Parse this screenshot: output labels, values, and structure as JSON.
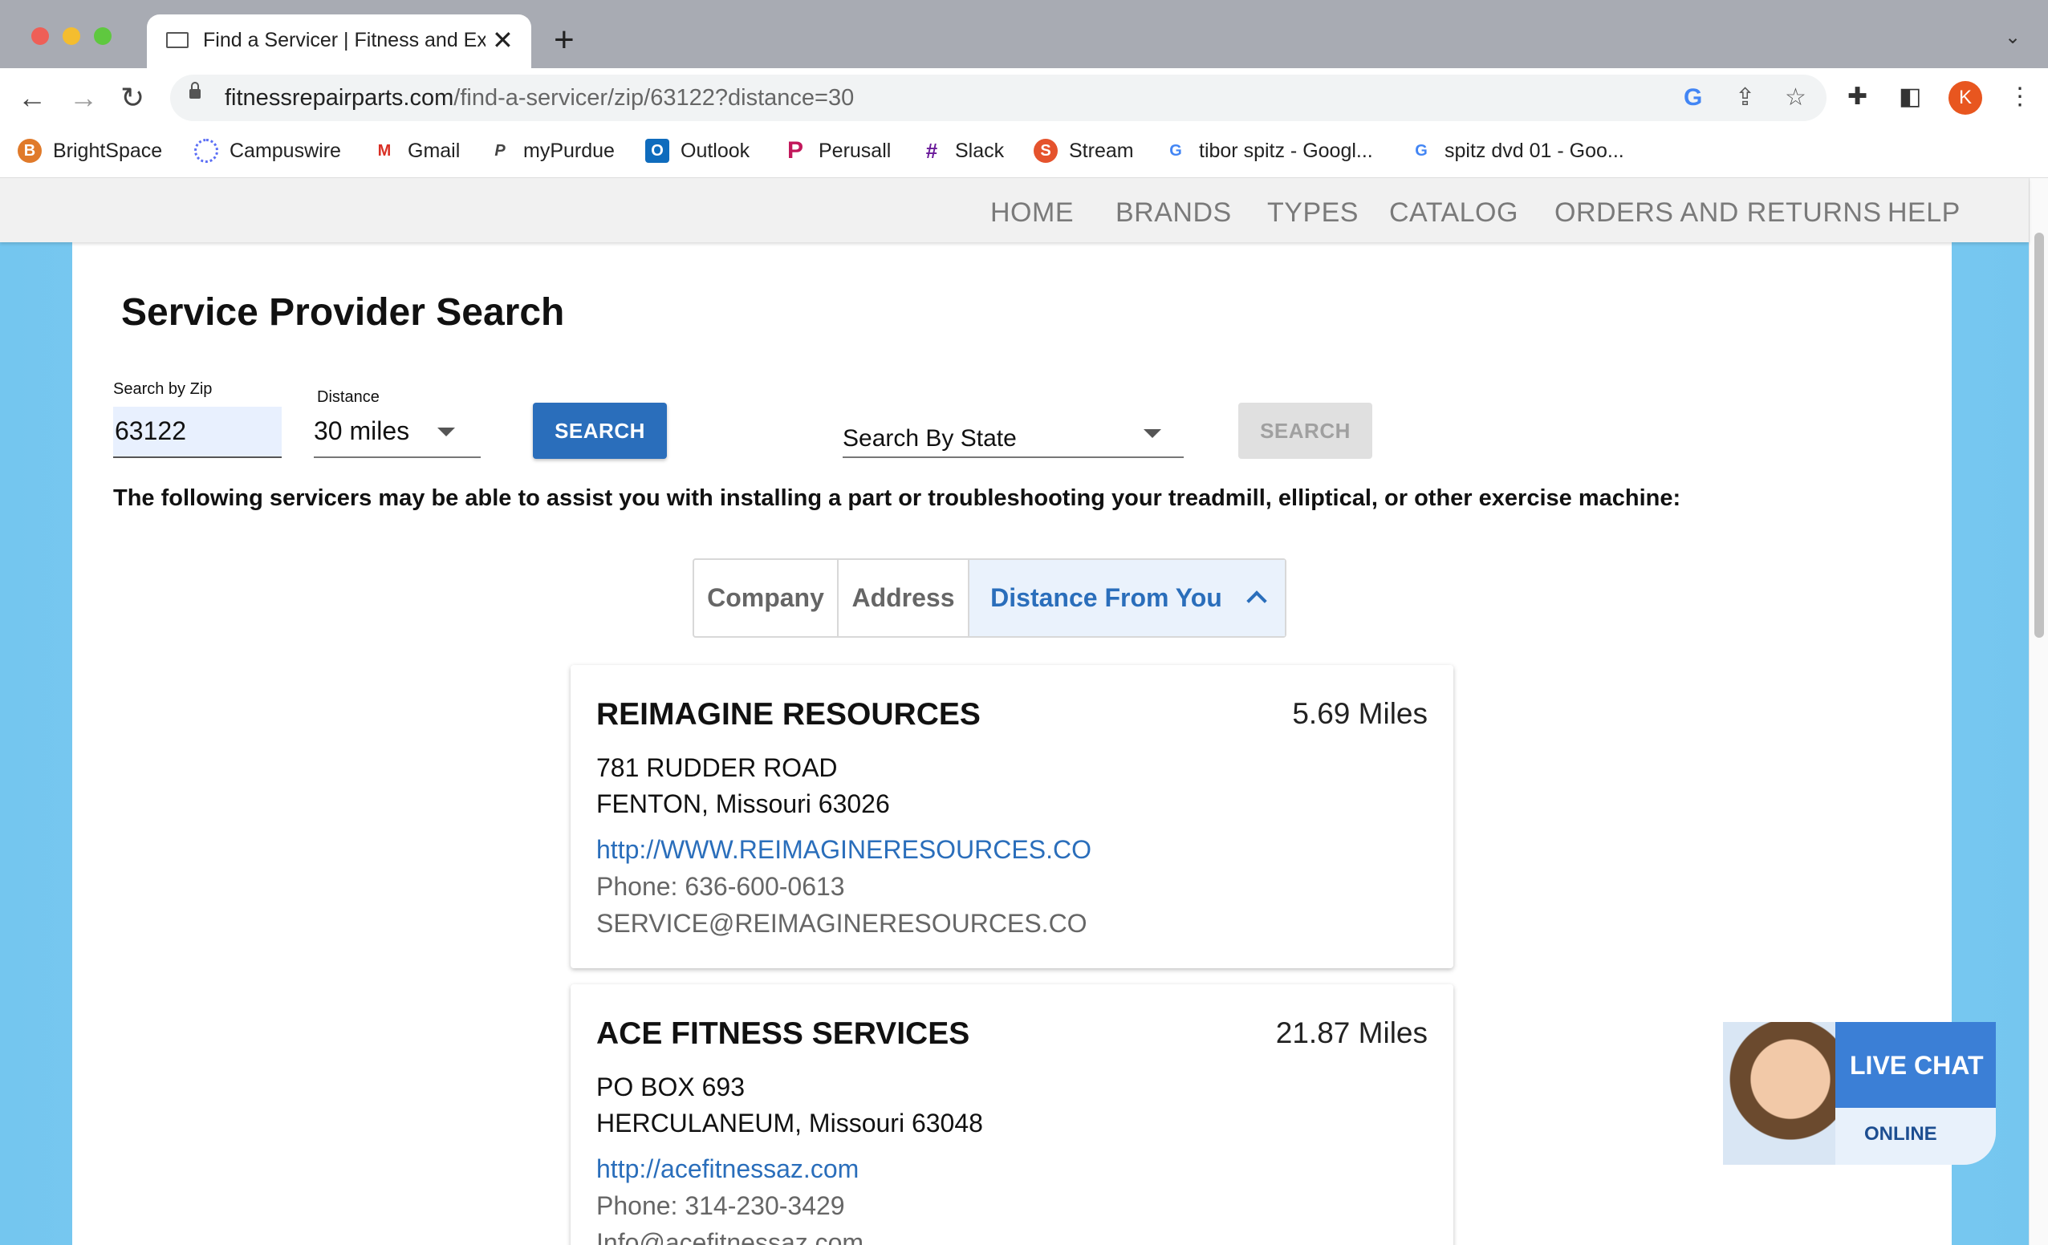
{
  "browser": {
    "tab_title": "Find a Servicer | Fitness and Exercise Equipment",
    "url_domain": "fitnessrepairparts.com",
    "url_path": "/find-a-servicer/zip/63122?distance=30",
    "profile_initial": "K",
    "bookmarks": [
      {
        "label": "BrightSpace",
        "icon": "B",
        "color": "#e07a2a"
      },
      {
        "label": "Campuswire",
        "icon": "○",
        "color": "#5b6ef5"
      },
      {
        "label": "Gmail",
        "icon": "M",
        "color": "#d93025"
      },
      {
        "label": "myPurdue",
        "icon": "P",
        "color": "#444444"
      },
      {
        "label": "Outlook",
        "icon": "O",
        "color": "#0f6cbd"
      },
      {
        "label": "Perusall",
        "icon": "P",
        "color": "#c2185b"
      },
      {
        "label": "Slack",
        "icon": "#",
        "color": "#6a1b9a"
      },
      {
        "label": "Stream",
        "icon": "S",
        "color": "#e5532d"
      },
      {
        "label": "tibor spitz - Googl...",
        "icon": "G",
        "color": "#4285f4"
      },
      {
        "label": "spitz dvd 01 - Goo...",
        "icon": "G",
        "color": "#4285f4"
      }
    ]
  },
  "site_nav": [
    "HOME",
    "BRANDS",
    "TYPES",
    "CATALOG",
    "ORDERS AND RETURNS",
    "HELP"
  ],
  "page": {
    "title": "Service Provider Search",
    "zip_label": "Search by Zip",
    "zip_value": "63122",
    "distance_label": "Distance",
    "distance_value": "30 miles",
    "search_button": "SEARCH",
    "state_placeholder": "Search By State",
    "search_button_2": "SEARCH",
    "intro": "The following servicers may be able to assist you with installing a part or troubleshooting your treadmill, elliptical, or other exercise machine:",
    "sort": {
      "company": "Company",
      "address": "Address",
      "distance": "Distance From You"
    }
  },
  "servicers": [
    {
      "name": "REIMAGINE RESOURCES",
      "distance": "5.69 Miles",
      "address1": "781 RUDDER ROAD",
      "address2": "FENTON, Missouri 63026",
      "website": "http://WWW.REIMAGINERESOURCES.CO",
      "phone": "Phone: 636-600-0613",
      "email": "SERVICE@REIMAGINERESOURCES.CO"
    },
    {
      "name": "ACE FITNESS SERVICES",
      "distance": "21.87 Miles",
      "address1": "PO BOX 693",
      "address2": "HERCULANEUM, Missouri 63048",
      "website": "http://acefitnessaz.com",
      "phone": "Phone: 314-230-3429",
      "email": "Info@acefitnessaz.com"
    }
  ],
  "livechat": {
    "title": "LIVE CHAT",
    "status": "ONLINE"
  }
}
